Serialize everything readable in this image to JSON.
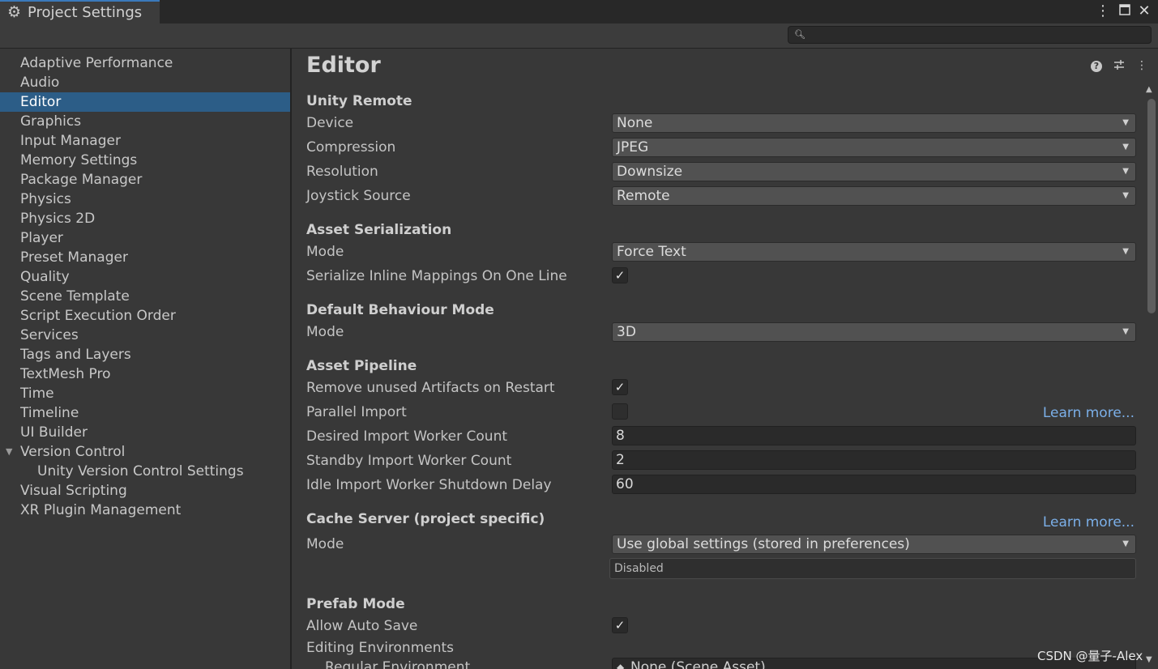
{
  "window": {
    "tab_title": "Project Settings",
    "icons": {
      "tab": "gear-icon",
      "menu": "kebab-menu-icon",
      "maximize": "maximize-icon",
      "close": "close-icon"
    }
  },
  "search": {
    "placeholder": ""
  },
  "sidebar": {
    "items": [
      {
        "label": "Adaptive Performance"
      },
      {
        "label": "Audio"
      },
      {
        "label": "Editor",
        "selected": true
      },
      {
        "label": "Graphics"
      },
      {
        "label": "Input Manager"
      },
      {
        "label": "Memory Settings"
      },
      {
        "label": "Package Manager"
      },
      {
        "label": "Physics"
      },
      {
        "label": "Physics 2D"
      },
      {
        "label": "Player"
      },
      {
        "label": "Preset Manager"
      },
      {
        "label": "Quality"
      },
      {
        "label": "Scene Template"
      },
      {
        "label": "Script Execution Order"
      },
      {
        "label": "Services"
      },
      {
        "label": "Tags and Layers"
      },
      {
        "label": "TextMesh Pro"
      },
      {
        "label": "Time"
      },
      {
        "label": "Timeline"
      },
      {
        "label": "UI Builder"
      },
      {
        "label": "Version Control",
        "expanded": true
      },
      {
        "label": "Unity Version Control Settings",
        "child": true
      },
      {
        "label": "Visual Scripting"
      },
      {
        "label": "XR Plugin Management"
      }
    ]
  },
  "main": {
    "title": "Editor",
    "header_icons": [
      "help-icon",
      "presets-icon",
      "kebab-menu-icon"
    ],
    "unity_remote": {
      "heading": "Unity Remote",
      "device": {
        "label": "Device",
        "value": "None"
      },
      "compression": {
        "label": "Compression",
        "value": "JPEG"
      },
      "resolution": {
        "label": "Resolution",
        "value": "Downsize"
      },
      "joystick": {
        "label": "Joystick Source",
        "value": "Remote"
      }
    },
    "asset_serialization": {
      "heading": "Asset Serialization",
      "mode": {
        "label": "Mode",
        "value": "Force Text"
      },
      "inline": {
        "label": "Serialize Inline Mappings On One Line",
        "checked": true
      }
    },
    "default_behaviour": {
      "heading": "Default Behaviour Mode",
      "mode": {
        "label": "Mode",
        "value": "3D"
      }
    },
    "asset_pipeline": {
      "heading": "Asset Pipeline",
      "remove_unused": {
        "label": "Remove unused Artifacts on Restart",
        "checked": true
      },
      "parallel": {
        "label": "Parallel Import",
        "checked": false
      },
      "learn_more": "Learn more...",
      "desired": {
        "label": "Desired Import Worker Count",
        "value": "8"
      },
      "standby": {
        "label": "Standby Import Worker Count",
        "value": "2"
      },
      "idle": {
        "label": "Idle Import Worker Shutdown Delay",
        "value": "60"
      }
    },
    "cache_server": {
      "heading": "Cache Server (project specific)",
      "learn_more": "Learn more...",
      "mode": {
        "label": "Mode",
        "value": "Use global settings (stored in preferences)"
      },
      "status": "Disabled"
    },
    "prefab_mode": {
      "heading": "Prefab Mode",
      "auto_save": {
        "label": "Allow Auto Save",
        "checked": true
      },
      "editing_env": {
        "label": "Editing Environments"
      },
      "regular_env": {
        "label": "Regular Environment",
        "value": "None (Scene Asset)"
      }
    }
  },
  "watermark": "CSDN @量子-Alex",
  "colors": {
    "accent": "#2c5d87",
    "link": "#7bafe8",
    "background": "#383838"
  }
}
